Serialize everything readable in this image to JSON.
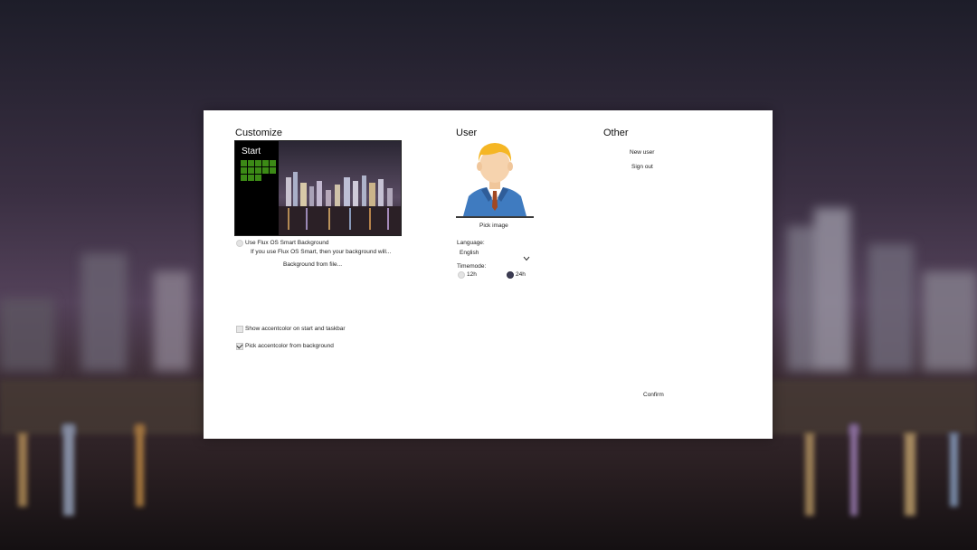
{
  "customize": {
    "title": "Customize",
    "preview_start_label": "Start",
    "smart_background_label": "Use Flux OS Smart Background",
    "smart_background_desc": "If you use Flux OS Smart, then your background will...",
    "background_from_file": "Background from file...",
    "accent_on_taskbar_label": "Show accentcolor on start and taskbar",
    "accent_on_taskbar_checked": false,
    "pick_accent_label": "Pick accentcolor from background",
    "pick_accent_checked": true
  },
  "user": {
    "title": "User",
    "pick_image": "Pick image",
    "language_label": "Language:",
    "language_value": "English",
    "timemode_label": "Timemode:",
    "timemode_options": [
      "12h",
      "24h"
    ],
    "timemode_selected": "24h"
  },
  "other": {
    "title": "Other",
    "new_user": "New user",
    "sign_out": "Sign out"
  },
  "confirm": "Confirm",
  "colors": {
    "tile_green": "#3c8a16",
    "radio_selected": "#3d3d55"
  },
  "icons": [
    "chevron-down-icon",
    "user-avatar-icon",
    "check-icon"
  ]
}
